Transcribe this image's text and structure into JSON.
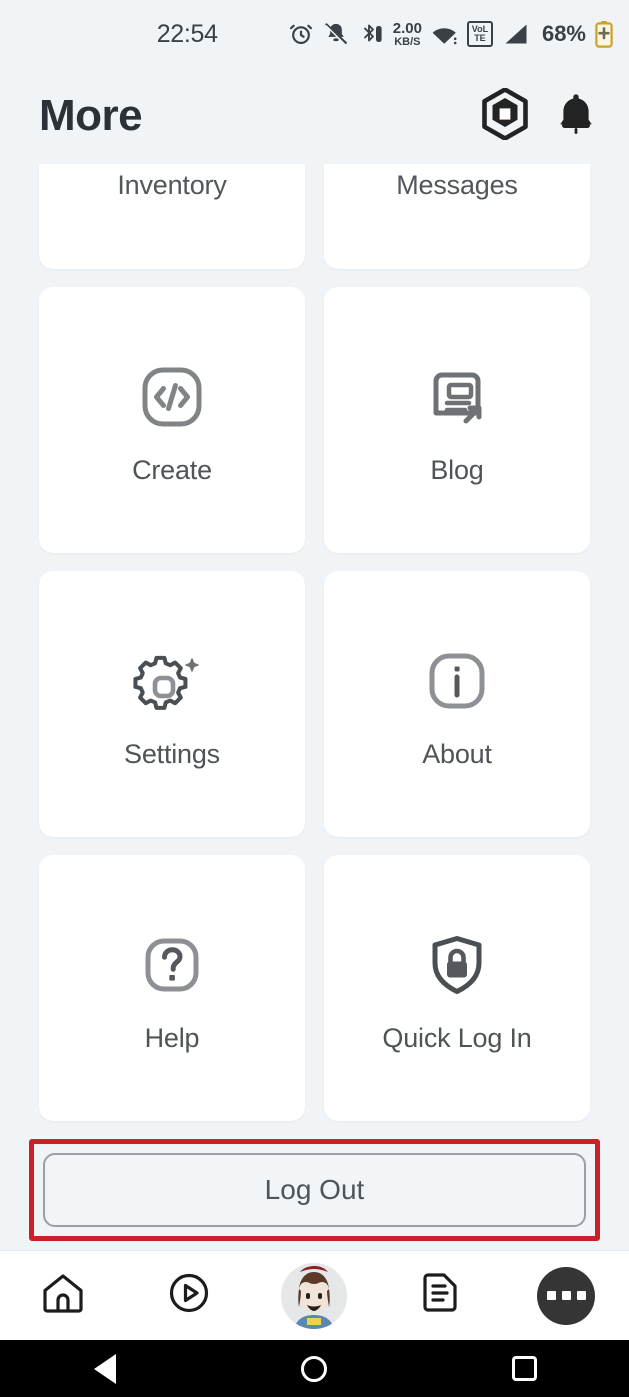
{
  "status_bar": {
    "time": "22:54",
    "data_rate_value": "2.00",
    "data_rate_unit": "KB/S",
    "volte_top": "VoLTE",
    "volte_line1": "VoL",
    "volte_line2": "TE",
    "battery_percent": "68%",
    "icons": [
      "alarm-icon",
      "notifications-off-icon",
      "bluetooth-icon",
      "wifi-icon",
      "volte-icon",
      "cellular-signal-icon",
      "battery-charging-icon"
    ]
  },
  "header": {
    "title": "More",
    "logo_icon": "roblox-logo-icon",
    "notifications_icon": "bell-icon"
  },
  "grid": {
    "items": [
      {
        "label": "Inventory",
        "icon": "inventory-icon",
        "clipped": true
      },
      {
        "label": "Messages",
        "icon": "messages-icon",
        "clipped": true
      },
      {
        "label": "Create",
        "icon": "code-brackets-icon",
        "clipped": false
      },
      {
        "label": "Blog",
        "icon": "blog-article-external-icon",
        "clipped": false
      },
      {
        "label": "Settings",
        "icon": "gear-sparkle-icon",
        "clipped": false
      },
      {
        "label": "About",
        "icon": "info-icon",
        "clipped": false
      },
      {
        "label": "Help",
        "icon": "question-mark-icon",
        "clipped": false
      },
      {
        "label": "Quick Log In",
        "icon": "shield-lock-icon",
        "clipped": false
      }
    ]
  },
  "logout": {
    "label": "Log Out",
    "highlight_color": "#cc2029"
  },
  "tabbar": {
    "items": [
      {
        "name": "home",
        "icon": "home-icon",
        "active": false
      },
      {
        "name": "discover",
        "icon": "play-circle-icon",
        "active": false
      },
      {
        "name": "avatar",
        "icon": "avatar-icon",
        "active": false
      },
      {
        "name": "chat",
        "icon": "chat-document-icon",
        "active": false
      },
      {
        "name": "more",
        "icon": "more-dots-icon",
        "active": true
      }
    ]
  },
  "android_nav": {
    "back": "back-triangle-icon",
    "home": "home-circle-icon",
    "recents": "recents-square-icon"
  },
  "colors": {
    "background": "#f0f4f7",
    "card": "#ffffff",
    "text": "#4f5458",
    "title": "#2c3138",
    "accent_highlight": "#cc2029"
  }
}
